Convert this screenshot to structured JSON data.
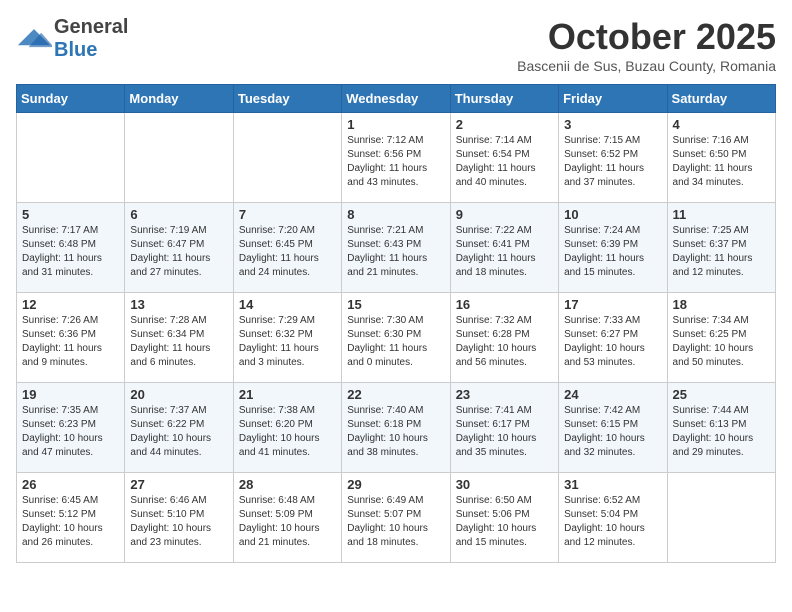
{
  "logo": {
    "general": "General",
    "blue": "Blue"
  },
  "title": "October 2025",
  "subtitle": "Bascenii de Sus, Buzau County, Romania",
  "days_of_week": [
    "Sunday",
    "Monday",
    "Tuesday",
    "Wednesday",
    "Thursday",
    "Friday",
    "Saturday"
  ],
  "weeks": [
    [
      {
        "day": "",
        "info": ""
      },
      {
        "day": "",
        "info": ""
      },
      {
        "day": "",
        "info": ""
      },
      {
        "day": "1",
        "info": "Sunrise: 7:12 AM\nSunset: 6:56 PM\nDaylight: 11 hours and 43 minutes."
      },
      {
        "day": "2",
        "info": "Sunrise: 7:14 AM\nSunset: 6:54 PM\nDaylight: 11 hours and 40 minutes."
      },
      {
        "day": "3",
        "info": "Sunrise: 7:15 AM\nSunset: 6:52 PM\nDaylight: 11 hours and 37 minutes."
      },
      {
        "day": "4",
        "info": "Sunrise: 7:16 AM\nSunset: 6:50 PM\nDaylight: 11 hours and 34 minutes."
      }
    ],
    [
      {
        "day": "5",
        "info": "Sunrise: 7:17 AM\nSunset: 6:48 PM\nDaylight: 11 hours and 31 minutes."
      },
      {
        "day": "6",
        "info": "Sunrise: 7:19 AM\nSunset: 6:47 PM\nDaylight: 11 hours and 27 minutes."
      },
      {
        "day": "7",
        "info": "Sunrise: 7:20 AM\nSunset: 6:45 PM\nDaylight: 11 hours and 24 minutes."
      },
      {
        "day": "8",
        "info": "Sunrise: 7:21 AM\nSunset: 6:43 PM\nDaylight: 11 hours and 21 minutes."
      },
      {
        "day": "9",
        "info": "Sunrise: 7:22 AM\nSunset: 6:41 PM\nDaylight: 11 hours and 18 minutes."
      },
      {
        "day": "10",
        "info": "Sunrise: 7:24 AM\nSunset: 6:39 PM\nDaylight: 11 hours and 15 minutes."
      },
      {
        "day": "11",
        "info": "Sunrise: 7:25 AM\nSunset: 6:37 PM\nDaylight: 11 hours and 12 minutes."
      }
    ],
    [
      {
        "day": "12",
        "info": "Sunrise: 7:26 AM\nSunset: 6:36 PM\nDaylight: 11 hours and 9 minutes."
      },
      {
        "day": "13",
        "info": "Sunrise: 7:28 AM\nSunset: 6:34 PM\nDaylight: 11 hours and 6 minutes."
      },
      {
        "day": "14",
        "info": "Sunrise: 7:29 AM\nSunset: 6:32 PM\nDaylight: 11 hours and 3 minutes."
      },
      {
        "day": "15",
        "info": "Sunrise: 7:30 AM\nSunset: 6:30 PM\nDaylight: 11 hours and 0 minutes."
      },
      {
        "day": "16",
        "info": "Sunrise: 7:32 AM\nSunset: 6:28 PM\nDaylight: 10 hours and 56 minutes."
      },
      {
        "day": "17",
        "info": "Sunrise: 7:33 AM\nSunset: 6:27 PM\nDaylight: 10 hours and 53 minutes."
      },
      {
        "day": "18",
        "info": "Sunrise: 7:34 AM\nSunset: 6:25 PM\nDaylight: 10 hours and 50 minutes."
      }
    ],
    [
      {
        "day": "19",
        "info": "Sunrise: 7:35 AM\nSunset: 6:23 PM\nDaylight: 10 hours and 47 minutes."
      },
      {
        "day": "20",
        "info": "Sunrise: 7:37 AM\nSunset: 6:22 PM\nDaylight: 10 hours and 44 minutes."
      },
      {
        "day": "21",
        "info": "Sunrise: 7:38 AM\nSunset: 6:20 PM\nDaylight: 10 hours and 41 minutes."
      },
      {
        "day": "22",
        "info": "Sunrise: 7:40 AM\nSunset: 6:18 PM\nDaylight: 10 hours and 38 minutes."
      },
      {
        "day": "23",
        "info": "Sunrise: 7:41 AM\nSunset: 6:17 PM\nDaylight: 10 hours and 35 minutes."
      },
      {
        "day": "24",
        "info": "Sunrise: 7:42 AM\nSunset: 6:15 PM\nDaylight: 10 hours and 32 minutes."
      },
      {
        "day": "25",
        "info": "Sunrise: 7:44 AM\nSunset: 6:13 PM\nDaylight: 10 hours and 29 minutes."
      }
    ],
    [
      {
        "day": "26",
        "info": "Sunrise: 6:45 AM\nSunset: 5:12 PM\nDaylight: 10 hours and 26 minutes."
      },
      {
        "day": "27",
        "info": "Sunrise: 6:46 AM\nSunset: 5:10 PM\nDaylight: 10 hours and 23 minutes."
      },
      {
        "day": "28",
        "info": "Sunrise: 6:48 AM\nSunset: 5:09 PM\nDaylight: 10 hours and 21 minutes."
      },
      {
        "day": "29",
        "info": "Sunrise: 6:49 AM\nSunset: 5:07 PM\nDaylight: 10 hours and 18 minutes."
      },
      {
        "day": "30",
        "info": "Sunrise: 6:50 AM\nSunset: 5:06 PM\nDaylight: 10 hours and 15 minutes."
      },
      {
        "day": "31",
        "info": "Sunrise: 6:52 AM\nSunset: 5:04 PM\nDaylight: 10 hours and 12 minutes."
      },
      {
        "day": "",
        "info": ""
      }
    ]
  ]
}
